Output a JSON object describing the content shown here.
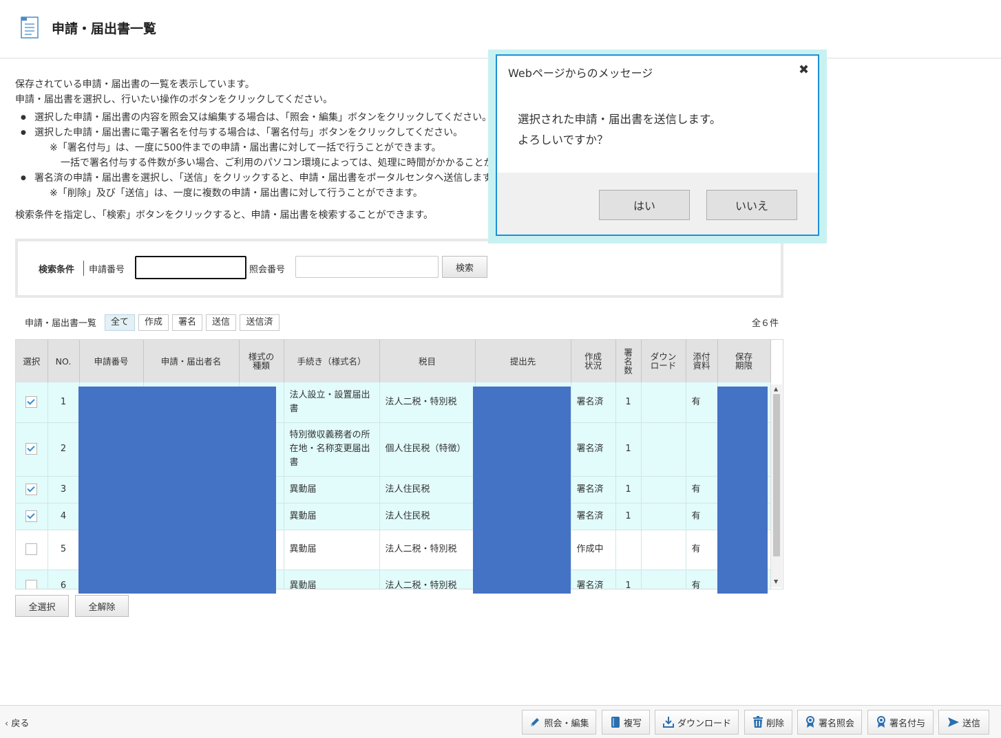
{
  "page": {
    "title": "申請・届出書一覧"
  },
  "description": {
    "line1": "保存されている申請・届出書の一覧を表示しています。",
    "line2": "申請・届出書を選択し、行いたい操作のボタンをクリックしてください。",
    "bullet1": "選択した申請・届出書の内容を照会又は編集する場合は、「照会・編集」ボタンをクリックしてください。",
    "bullet2": "選択した申請・届出書に電子署名を付与する場合は、「署名付与」ボタンをクリックしてください。",
    "note1": "※「署名付与」は、一度に500件までの申請・届出書に対して一括で行うことができます。",
    "note2": "一括で署名付与する件数が多い場合、ご利用のパソコン環境によっては、処理に時間がかかることがあります。",
    "bullet3": "署名済の申請・届出書を選択し、「送信」をクリックすると、申請・届出書をポータルセンタへ送信します。",
    "note3": "※「削除」及び「送信」は、一度に複数の申請・届出書に対して行うことができます。",
    "search_hint": "検索条件を指定し、「検索」ボタンをクリックすると、申請・届出書を検索することができます。"
  },
  "search": {
    "label": "検索条件",
    "app_no_label": "申請番号",
    "app_no_value": "",
    "ref_no_label": "照会番号",
    "ref_no_value": "",
    "button": "検索"
  },
  "list": {
    "caption": "申請・届出書一覧",
    "filters": [
      "全て",
      "作成",
      "署名",
      "送信",
      "送信済"
    ],
    "active_filter": "全て",
    "count": "全６件"
  },
  "table": {
    "headers": [
      "選択",
      "NO.",
      "申請番号",
      "申請・届出者名",
      "様式の\n種類",
      "手続き（様式名）",
      "税目",
      "提出先",
      "作成\n状況",
      "署\n名\n数",
      "ダウン\nロード",
      "添付\n資料",
      "保存\n期限"
    ],
    "rows": [
      {
        "checked": true,
        "no": "1",
        "procedure": "法人設立・設置届出書",
        "tax": "法人二税・特別税",
        "status": "署名済",
        "sigs": "1",
        "download": "",
        "attach": "有"
      },
      {
        "checked": true,
        "no": "2",
        "procedure": "特別徴収義務者の所在地・名称変更届出書",
        "tax": "個人住民税（特徴）",
        "status": "署名済",
        "sigs": "1",
        "download": "",
        "attach": ""
      },
      {
        "checked": true,
        "no": "3",
        "procedure": "異動届",
        "tax": "法人住民税",
        "status": "署名済",
        "sigs": "1",
        "download": "",
        "attach": "有"
      },
      {
        "checked": true,
        "no": "4",
        "procedure": "異動届",
        "tax": "法人住民税",
        "status": "署名済",
        "sigs": "1",
        "download": "",
        "attach": "有"
      },
      {
        "checked": false,
        "no": "5",
        "procedure": "異動届",
        "tax": "法人二税・特別税",
        "status": "作成中",
        "sigs": "",
        "download": "",
        "attach": "有"
      },
      {
        "checked": false,
        "no": "6",
        "procedure": "異動届",
        "tax": "法人二税・特別税",
        "status": "署名済",
        "sigs": "1",
        "download": "",
        "attach": "有"
      }
    ]
  },
  "select_all": "全選択",
  "clear_all": "全解除",
  "footer": {
    "back": "戻る",
    "buttons": [
      "照会・編集",
      "複写",
      "ダウンロード",
      "削除",
      "署名照会",
      "署名付与",
      "送信"
    ]
  },
  "dialog": {
    "title": "Webページからのメッセージ",
    "line1": "選択された申請・届出書を送信します。",
    "line2": "よろしいですか？",
    "yes": "はい",
    "no": "いいえ"
  },
  "colors": {
    "accent": "#1d8fd6",
    "row_bg": "#e2fbfb",
    "redaction": "#4472c4",
    "icon_blue": "#2a6fb0"
  }
}
